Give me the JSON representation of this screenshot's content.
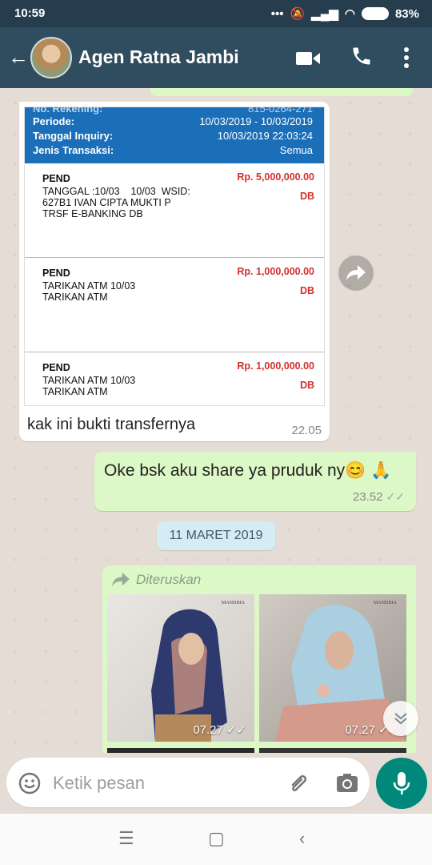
{
  "status_bar": {
    "time": "10:59",
    "battery": "83%"
  },
  "header": {
    "contact_name": "Agen Ratna Jambi"
  },
  "statement": {
    "rekening_label": "No. Rekening:",
    "rekening_value": "815-0264-271",
    "periode_label": "Periode:",
    "periode_value": "10/03/2019 - 10/03/2019",
    "tanggal_label": "Tanggal Inquiry:",
    "tanggal_value": "10/03/2019 22:03:24",
    "jenis_label": "Jenis Transaksi:",
    "jenis_value": "Semua",
    "transactions": [
      {
        "type": "PEND",
        "desc": "TANGGAL :10/03    10/03  WSID:\n627B1 IVAN CIPTA MUKTI P\nTRSF E-BANKING DB",
        "amount": "Rp.  5,000,000.00",
        "dc": "DB"
      },
      {
        "type": "PEND",
        "desc": "TARIKAN ATM 10/03\nTARIKAN ATM",
        "amount": "Rp.  1,000,000.00",
        "dc": "DB"
      },
      {
        "type": "PEND",
        "desc": "TARIKAN ATM 10/03\nTARIKAN ATM",
        "amount": "Rp.  1,000,000.00",
        "dc": "DB"
      }
    ]
  },
  "messages": {
    "incoming_caption": "kak ini bukti transfernya",
    "incoming_time": "22.05",
    "outgoing_text": "Oke bsk aku share ya pruduk ny😊 🙏",
    "outgoing_time": "23.52",
    "date_chip": "11 MARET 2019",
    "forwarded_label": "Diteruskan",
    "photo1_time": "07.27",
    "photo2_time": "07.27",
    "photo_brand": "MANDIHA"
  },
  "input": {
    "placeholder": "Ketik pesan"
  },
  "colors": {
    "header": "#2f4d5e",
    "statusbar": "#263d4d",
    "outgoing_bubble": "#dcf8c6",
    "mic": "#00897b",
    "bank_header": "#1a6fb8",
    "amount": "#d32f2f"
  }
}
